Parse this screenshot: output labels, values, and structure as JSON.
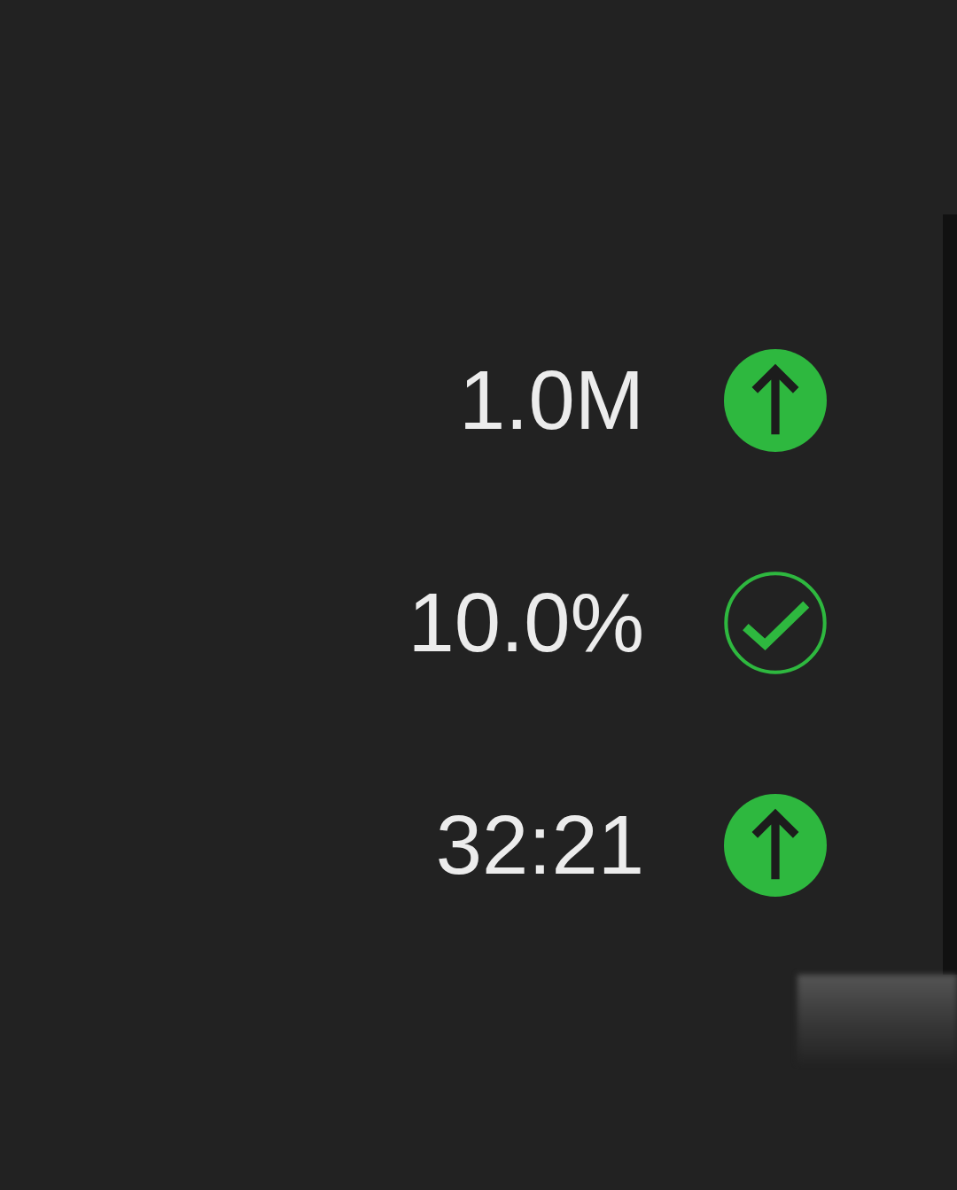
{
  "rows": [
    {
      "value": "1.0M",
      "kind": "up"
    },
    {
      "value": "10.0%",
      "kind": "check"
    },
    {
      "value": "32:21",
      "kind": "up"
    }
  ]
}
